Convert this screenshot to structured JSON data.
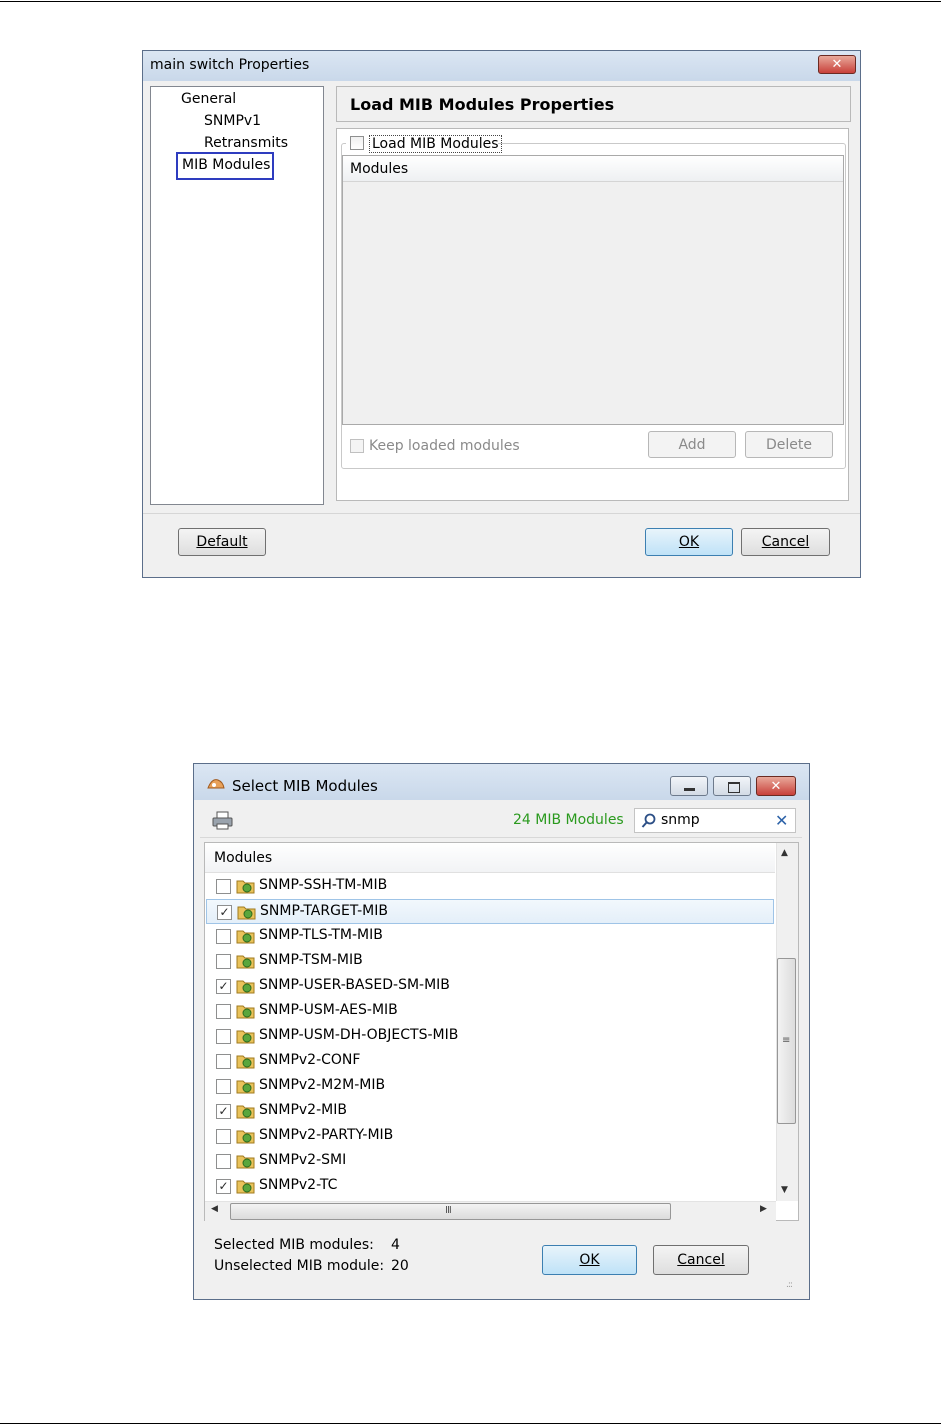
{
  "dialog1": {
    "title": "main switch Properties",
    "tree": [
      "General",
      "SNMPv1",
      "Retransmits",
      "MIB Modules"
    ],
    "header": "Load MIB Modules Properties",
    "load_checkbox_label": "Load MIB Modules",
    "modules_column": "Modules",
    "keep_loaded_label": "Keep loaded modules",
    "add_label": "Add",
    "delete_label": "Delete",
    "default_label": "Default",
    "ok_label": "OK",
    "cancel_label": "Cancel"
  },
  "dialog2": {
    "title": "Select MIB Modules",
    "count_text": "24 MIB Modules",
    "search_value": "snmp",
    "column_header": "Modules",
    "modules": [
      {
        "name": "SNMP-SSH-TM-MIB",
        "checked": false
      },
      {
        "name": "SNMP-TARGET-MIB",
        "checked": true
      },
      {
        "name": "SNMP-TLS-TM-MIB",
        "checked": false
      },
      {
        "name": "SNMP-TSM-MIB",
        "checked": false
      },
      {
        "name": "SNMP-USER-BASED-SM-MIB",
        "checked": true
      },
      {
        "name": "SNMP-USM-AES-MIB",
        "checked": false
      },
      {
        "name": "SNMP-USM-DH-OBJECTS-MIB",
        "checked": false
      },
      {
        "name": "SNMPv2-CONF",
        "checked": false
      },
      {
        "name": "SNMPv2-M2M-MIB",
        "checked": false
      },
      {
        "name": "SNMPv2-MIB",
        "checked": true
      },
      {
        "name": "SNMPv2-PARTY-MIB",
        "checked": false
      },
      {
        "name": "SNMPv2-SMI",
        "checked": false
      },
      {
        "name": "SNMPv2-TC",
        "checked": true
      }
    ],
    "selected_label": "Selected MIB modules:",
    "selected_count": "4",
    "unselected_label": "Unselected MIB module:",
    "unselected_count": "20",
    "ok_label": "OK",
    "cancel_label": "Cancel"
  },
  "colors": {
    "highlight_border": "#2e3cbf",
    "count_green": "#2a9a1e",
    "close_red": "#c8403a"
  }
}
